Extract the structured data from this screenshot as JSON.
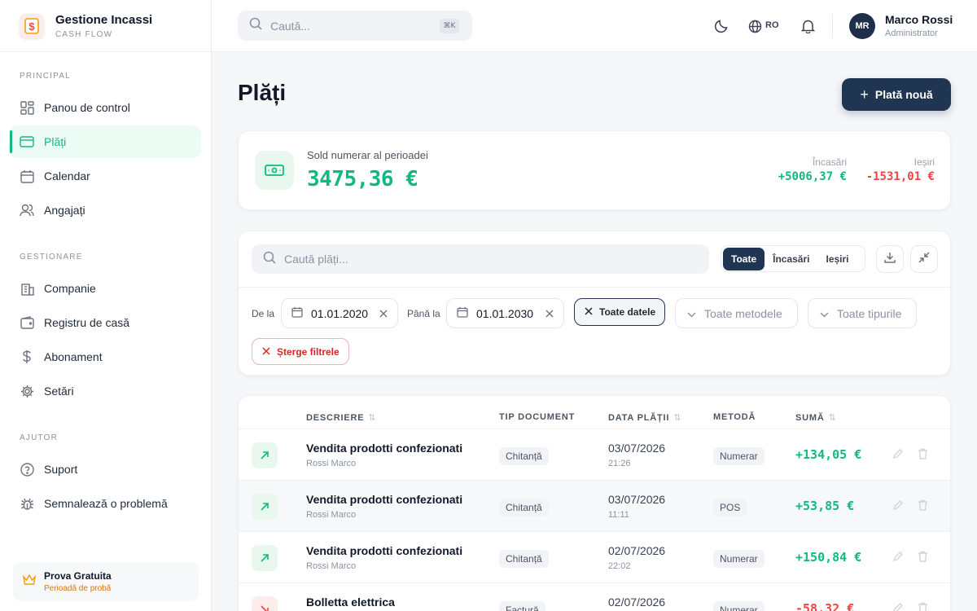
{
  "brand": {
    "title": "Gestione Incassi",
    "subtitle": "CASH FLOW"
  },
  "sidebar": {
    "sections": [
      {
        "title": "PRINCIPAL"
      },
      {
        "title": "GESTIONARE"
      },
      {
        "title": "AJUTOR"
      }
    ],
    "items": [
      {
        "label": "Panou de control",
        "icon": "dashboard-icon"
      },
      {
        "label": "Plăți",
        "icon": "card-icon",
        "active": true
      },
      {
        "label": "Calendar",
        "icon": "calendar-icon"
      },
      {
        "label": "Angajați",
        "icon": "users-icon"
      },
      {
        "label": "Companie",
        "icon": "building-icon"
      },
      {
        "label": "Registru de casă",
        "icon": "wallet-icon"
      },
      {
        "label": "Abonament",
        "icon": "dollar-icon"
      },
      {
        "label": "Setări",
        "icon": "gear-icon"
      },
      {
        "label": "Suport",
        "icon": "help-icon"
      },
      {
        "label": "Semnalează o problemă",
        "icon": "bug-icon"
      }
    ],
    "trial": {
      "title": "Prova Gratuita",
      "subtitle": "Perioadă de probă"
    }
  },
  "topbar": {
    "search_placeholder": "Caută...",
    "shortcut": "⌘K",
    "language": "RO",
    "user": {
      "initials": "MR",
      "name": "Marco Rossi",
      "role": "Administrator"
    }
  },
  "page": {
    "title": "Plăți",
    "new_button": "Plată nouă"
  },
  "balance": {
    "label": "Sold numerar al perioadei",
    "amount": "3475,36 €",
    "income_label": "Încasări",
    "income_value": "+5006,37 €",
    "expense_label": "Ieșiri",
    "expense_value": "-1531,01 €"
  },
  "filters": {
    "search_placeholder": "Caută plăți...",
    "segments": [
      "Toate",
      "Încasări",
      "Ieșiri"
    ],
    "active_segment": "Toate",
    "from_label": "De la",
    "from_value": "01.01.2020",
    "to_label": "Până la",
    "to_value": "01.01.2030",
    "all_dates_chip": "Toate datele",
    "methods_placeholder": "Toate metodele",
    "types_placeholder": "Toate tipurile",
    "clear_label": "Șterge filtrele"
  },
  "table": {
    "columns": [
      "DESCRIERE",
      "TIP DOCUMENT",
      "DATA PLĂȚII",
      "METODĂ",
      "SUMĂ"
    ],
    "rows": [
      {
        "title": "Vendita prodotti confezionati",
        "person": "Rossi Marco",
        "doc": "Chitanță",
        "date": "03/07/2026",
        "time": "21:26",
        "method": "Numerar",
        "amount": "+134,05 €",
        "direction": "in"
      },
      {
        "title": "Vendita prodotti confezionati",
        "person": "Rossi Marco",
        "doc": "Chitanță",
        "date": "03/07/2026",
        "time": "11:11",
        "method": "POS",
        "amount": "+53,85 €",
        "direction": "in"
      },
      {
        "title": "Vendita prodotti confezionati",
        "person": "Rossi Marco",
        "doc": "Chitanță",
        "date": "02/07/2026",
        "time": "22:02",
        "method": "Numerar",
        "amount": "+150,84 €",
        "direction": "in"
      },
      {
        "title": "Bolletta elettrica",
        "person": "",
        "doc": "Factură",
        "date": "02/07/2026",
        "time": "",
        "method": "Numerar",
        "amount": "-58,32 €",
        "direction": "out"
      }
    ]
  },
  "colors": {
    "accent": "#10b981",
    "primary": "#1f3552",
    "danger": "#ef4444",
    "warning": "#d97706"
  }
}
